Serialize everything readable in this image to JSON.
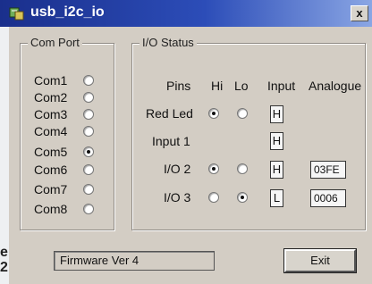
{
  "window": {
    "title": "usb_i2c_io",
    "close_label": "x"
  },
  "com_port": {
    "label": "Com Port",
    "ports": [
      {
        "label": "Com1",
        "selected": false
      },
      {
        "label": "Com2",
        "selected": false
      },
      {
        "label": "Com3",
        "selected": false
      },
      {
        "label": "Com4",
        "selected": false
      },
      {
        "label": "Com5",
        "selected": true
      },
      {
        "label": "Com6",
        "selected": false
      },
      {
        "label": "Com7",
        "selected": false
      },
      {
        "label": "Com8",
        "selected": false
      }
    ]
  },
  "io_status": {
    "label": "I/O Status",
    "headers": {
      "pins": "Pins",
      "hi": "Hi",
      "lo": "Lo",
      "input": "Input",
      "analogue": "Analogue"
    },
    "rows": [
      {
        "name": "Red Led",
        "hi": true,
        "lo": false,
        "input": "H",
        "analogue": ""
      },
      {
        "name": "Input 1",
        "input": "H",
        "analogue": ""
      },
      {
        "name": "I/O 2",
        "hi": true,
        "lo": false,
        "input": "H",
        "analogue": "03FE"
      },
      {
        "name": "I/O 3",
        "hi": false,
        "lo": true,
        "input": "L",
        "analogue": "0006"
      }
    ]
  },
  "status_bar": {
    "firmware": "Firmware Ver 4"
  },
  "buttons": {
    "exit": "Exit"
  },
  "side_glyphs": [
    "e",
    "2"
  ]
}
